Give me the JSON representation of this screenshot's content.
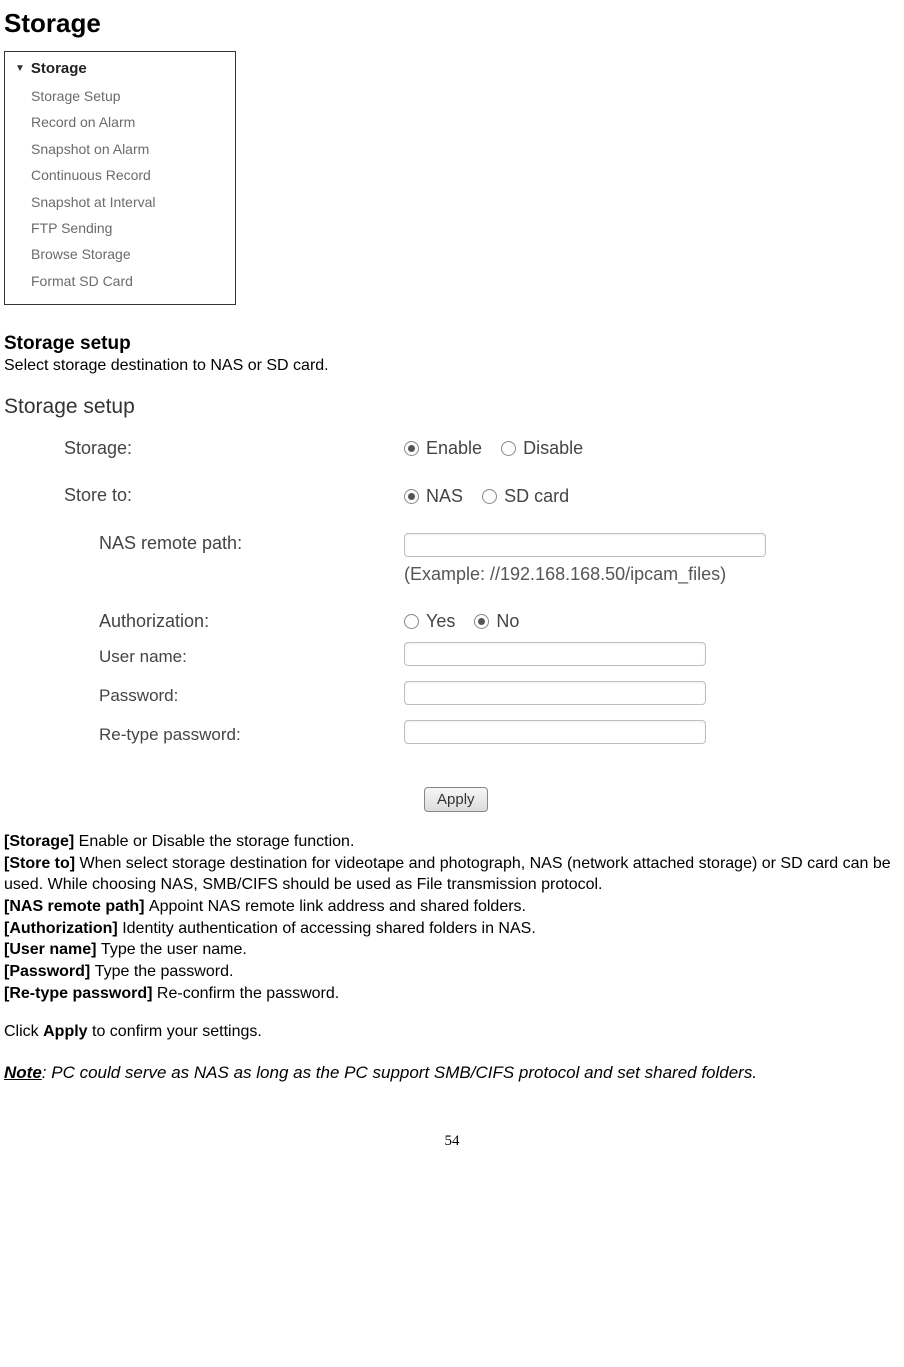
{
  "headings": {
    "main": "Storage",
    "sub": "Storage setup"
  },
  "intro": "Select storage destination to NAS or SD card.",
  "menu": {
    "title": "Storage",
    "items": [
      "Storage Setup",
      "Record on Alarm",
      "Snapshot on Alarm",
      "Continuous Record",
      "Snapshot at Interval",
      "FTP Sending",
      "Browse Storage",
      "Format SD Card"
    ]
  },
  "form": {
    "title": "Storage setup",
    "storage_label": "Storage:",
    "storage_opt1": "Enable",
    "storage_opt2": "Disable",
    "storeto_label": "Store to:",
    "storeto_opt1": "NAS",
    "storeto_opt2": "SD card",
    "naspath_label": "NAS remote path:",
    "naspath_example": "(Example: //192.168.168.50/ipcam_files)",
    "auth_label": "Authorization:",
    "auth_opt1": "Yes",
    "auth_opt2": "No",
    "username_label": "User name:",
    "password_label": "Password:",
    "repassword_label": "Re-type password:",
    "apply_label": "Apply"
  },
  "definitions": {
    "storage_key": "[Storage] ",
    "storage_text": "Enable or Disable the storage function.",
    "storeto_key": "[Store to] ",
    "storeto_text": "When select storage destination for videotape and photograph, NAS (network attached storage) or SD card can be used. While choosing NAS, SMB/CIFS should be used as File transmission protocol.",
    "naspath_key": "[NAS remote path] ",
    "naspath_text": "Appoint NAS remote link address and shared folders.",
    "auth_key": "[Authorization] ",
    "auth_text": "Identity authentication of accessing shared folders in NAS.",
    "username_key": "[User name] ",
    "username_text": "Type the user name.",
    "password_key": "[Password] ",
    "password_text": "Type the password.",
    "repassword_key": "[Re-type password] ",
    "repassword_text": "Re-confirm the password.",
    "click": "Click ",
    "apply_word": "Apply",
    "click_tail": " to confirm your settings."
  },
  "note": {
    "label": "Note",
    "body": ": PC could serve as NAS as long as the PC support SMB/CIFS protocol and set shared folders."
  },
  "page_number": "54"
}
